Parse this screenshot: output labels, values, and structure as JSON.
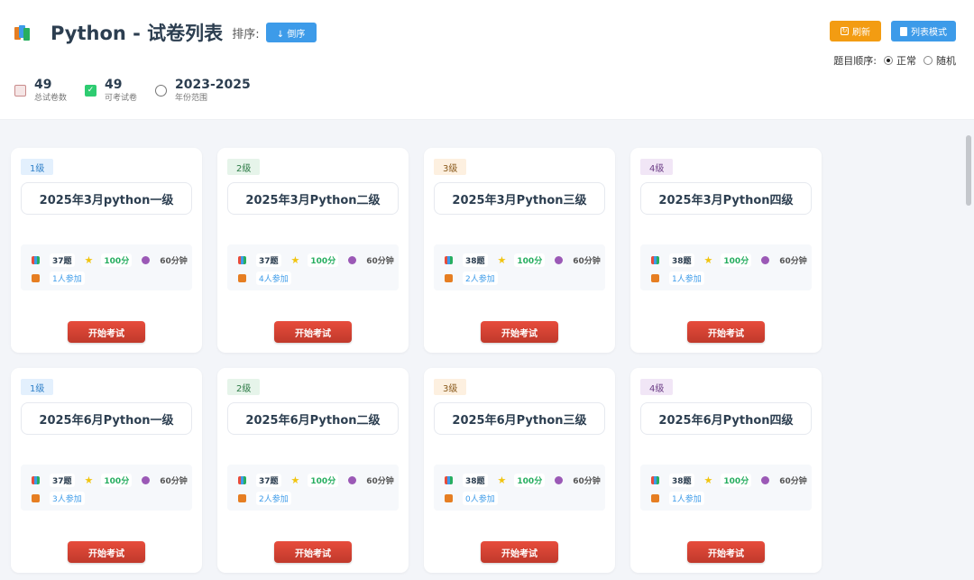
{
  "header": {
    "title": "Python - 试卷列表",
    "sort_label": "排序:",
    "sort_button": "↓ 倒序",
    "refresh_button": "刷新",
    "list_mode_button": "列表模式",
    "order_label": "题目顺序:",
    "order_options": [
      "正常",
      "随机"
    ],
    "order_selected": "正常"
  },
  "stats": [
    {
      "value": "49",
      "label": "总试卷数",
      "icon": "clipboard-icon"
    },
    {
      "value": "49",
      "label": "可考试卷",
      "icon": "check-icon"
    },
    {
      "value": "2023-2025",
      "label": "年份范围",
      "icon": "clock-icon"
    }
  ],
  "colors": {
    "primary": "#3d9be9",
    "warning": "#f39c12",
    "danger": "#e74c3c",
    "success": "#27ae60"
  },
  "cards": [
    {
      "level": "1级",
      "title": "2025年3月python一级",
      "questions": "37题",
      "score": "100分",
      "time": "60分钟",
      "joined": "1人参加",
      "button": "开始考试"
    },
    {
      "level": "2级",
      "title": "2025年3月Python二级",
      "questions": "37题",
      "score": "100分",
      "time": "60分钟",
      "joined": "4人参加",
      "button": "开始考试"
    },
    {
      "level": "3级",
      "title": "2025年3月Python三级",
      "questions": "38题",
      "score": "100分",
      "time": "60分钟",
      "joined": "2人参加",
      "button": "开始考试"
    },
    {
      "level": "4级",
      "title": "2025年3月Python四级",
      "questions": "38题",
      "score": "100分",
      "time": "60分钟",
      "joined": "1人参加",
      "button": "开始考试"
    },
    {
      "level": "1级",
      "title": "2025年6月Python一级",
      "questions": "37题",
      "score": "100分",
      "time": "60分钟",
      "joined": "3人参加",
      "button": "开始考试"
    },
    {
      "level": "2级",
      "title": "2025年6月Python二级",
      "questions": "37题",
      "score": "100分",
      "time": "60分钟",
      "joined": "2人参加",
      "button": "开始考试"
    },
    {
      "level": "3级",
      "title": "2025年6月Python三级",
      "questions": "38题",
      "score": "100分",
      "time": "60分钟",
      "joined": "0人参加",
      "button": "开始考试"
    },
    {
      "level": "4级",
      "title": "2025年6月Python四级",
      "questions": "38题",
      "score": "100分",
      "time": "60分钟",
      "joined": "1人参加",
      "button": "开始考试"
    }
  ]
}
